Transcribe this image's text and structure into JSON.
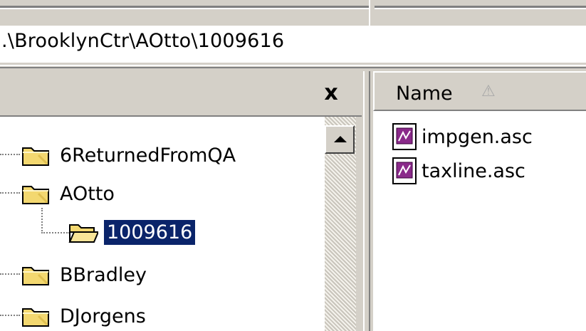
{
  "address": {
    "path": ".\\BrooklynCtr\\AOtto\\1009616"
  },
  "folders_pane": {
    "close_glyph": "x",
    "items": [
      {
        "label": "6ReturnedFromQA",
        "selected": false
      },
      {
        "label": "AOtto",
        "selected": false
      },
      {
        "label": "1009616",
        "selected": true
      },
      {
        "label": "BBradley",
        "selected": false
      },
      {
        "label": "DJorgens",
        "selected": false
      }
    ]
  },
  "file_list": {
    "columns": [
      {
        "label": "Name",
        "sort_glyph": "⚠"
      }
    ],
    "files": [
      {
        "name": "impgen.asc",
        "icon": "asc-file-icon"
      },
      {
        "name": "taxline.asc",
        "icon": "asc-file-icon"
      }
    ]
  },
  "colors": {
    "selection": "#0a246a",
    "chrome": "#d4d0c8",
    "folder_yellow": "#f3d870"
  }
}
